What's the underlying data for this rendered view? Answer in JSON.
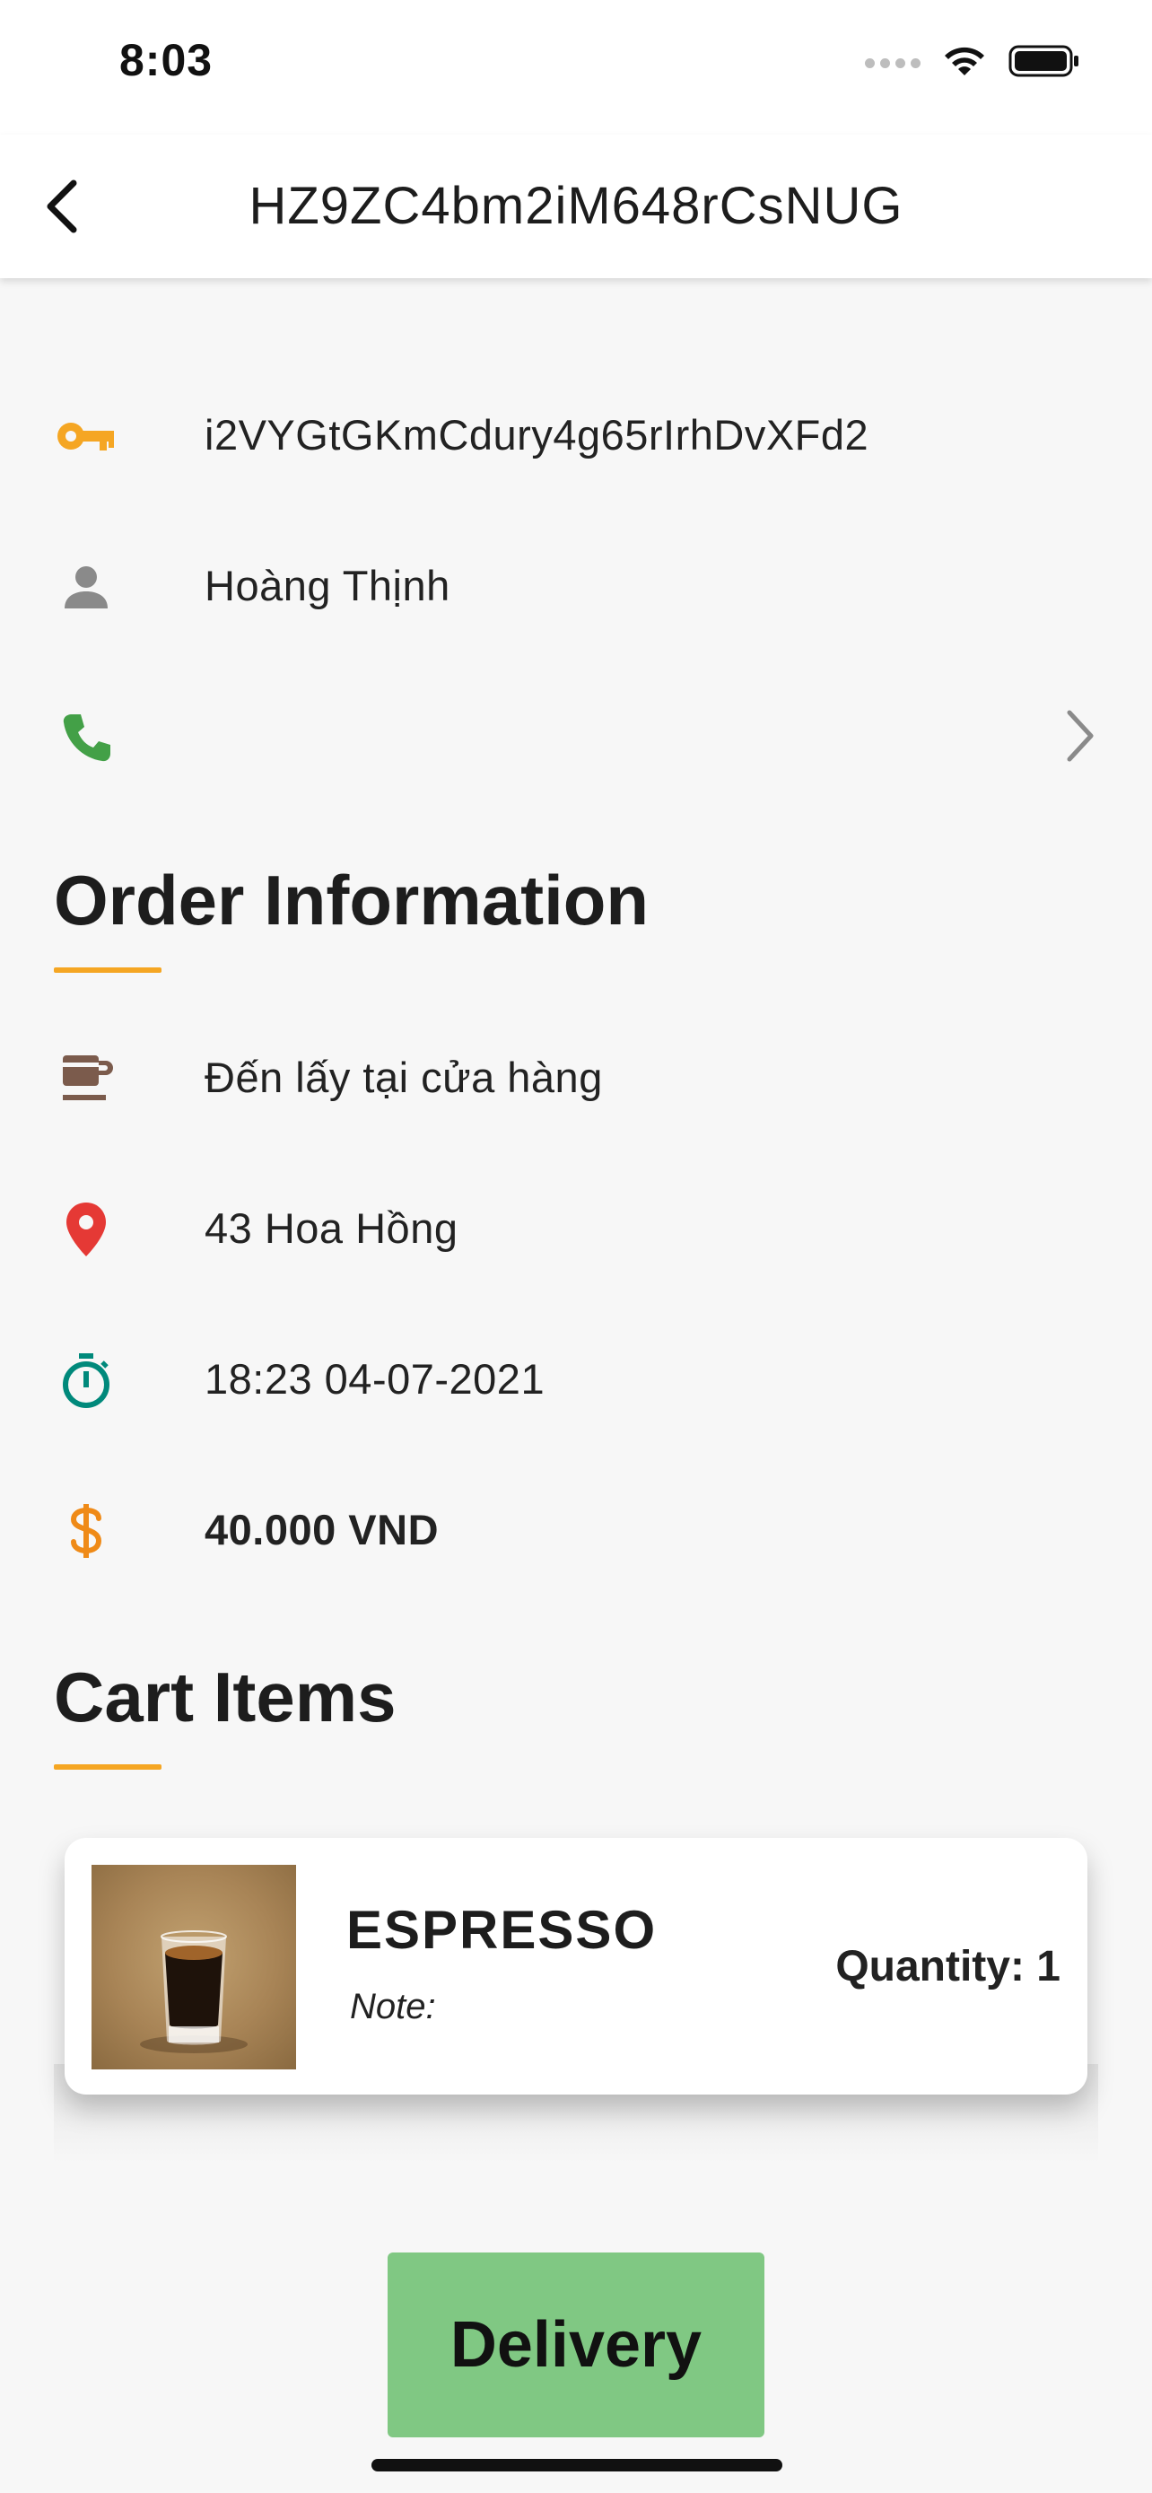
{
  "status_bar": {
    "time": "8:03"
  },
  "app_bar": {
    "title": "HZ9ZC4bm2iM648rCsNUG"
  },
  "customer": {
    "id": "i2VYGtGKmCdury4g65rIrhDvXFd2",
    "name": "Hoàng Thịnh",
    "phone": ""
  },
  "order_information": {
    "title": "Order Information",
    "method": "Đến lấy tại cửa hàng",
    "address": "43 Hoa Hồng",
    "time": "18:23 04-07-2021",
    "total": "40.000 VND"
  },
  "cart": {
    "title": "Cart Items",
    "items": [
      {
        "name": "ESPRESSO",
        "note": "Note:",
        "quantity": "Quantity: 1"
      }
    ]
  },
  "actions": {
    "delivery_label": "Delivery"
  },
  "colors": {
    "key_icon": "#f5a623",
    "person_icon": "#8a8a8a",
    "phone_icon": "#43a047",
    "cup_icon": "#7b5b4c",
    "pin_icon": "#e53935",
    "timer_icon": "#00897b",
    "dollar_icon": "#ef8a17",
    "accent_underline": "#f5a623",
    "delivery_button": "#80c883"
  }
}
